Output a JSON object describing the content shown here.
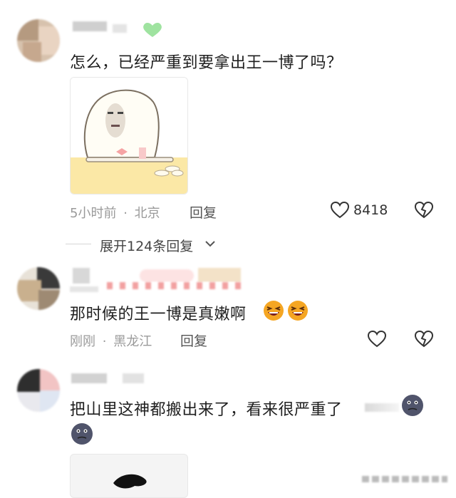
{
  "comments": [
    {
      "text": "怎么，已经严重到要拿出王一博了吗？",
      "time": "5小时前",
      "separator": "·",
      "location": "北京",
      "reply_label": "回复",
      "like_count": "8418"
    },
    {
      "text": "那时候的王一博是真嫩啊",
      "time": "刚刚",
      "separator": "·",
      "location": "黑龙江",
      "reply_label": "回复",
      "like_count": ""
    },
    {
      "text": "把山里这神都搬出来了，看来很严重了",
      "time": "",
      "location": "",
      "reply_label": "",
      "like_count": ""
    }
  ],
  "expand_replies": {
    "label": "展开124条回复"
  },
  "colors": {
    "meta_gray": "#9a9a9a",
    "accent_green": "#9fe3a0",
    "meme_yellow": "#fbe8a6",
    "emoji_orange": "#f5a623",
    "emoji_dark": "#50546b"
  },
  "icons": [
    "heart-icon",
    "heart-broken-icon",
    "chevron-down-icon",
    "laughing-emoji-icon",
    "dark-face-emoji-icon"
  ]
}
